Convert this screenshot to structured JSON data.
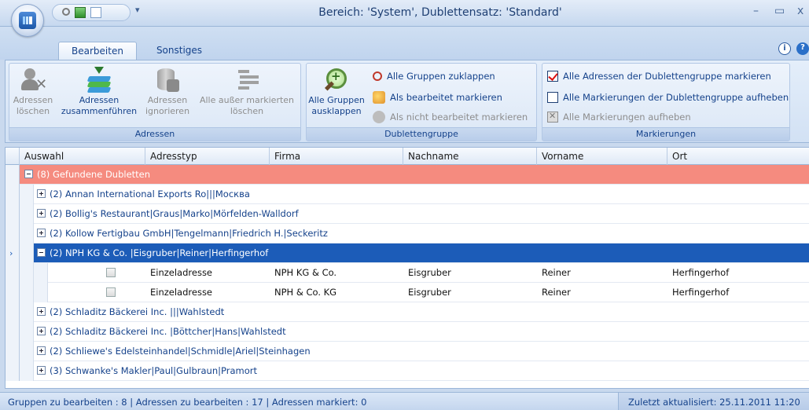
{
  "window": {
    "title": "Bereich: 'System', Dublettensatz: 'Standard'",
    "minimize": "–",
    "maximize": "▭",
    "close": "x",
    "qat_dropdown": "▾"
  },
  "tabs": [
    {
      "label": "Bearbeiten",
      "active": true
    },
    {
      "label": "Sonstiges",
      "active": false
    }
  ],
  "help": {
    "info": "i",
    "question": "?"
  },
  "ribbon": {
    "adressen": {
      "label": "Adressen",
      "delete": {
        "line1": "Adressen",
        "line2": "löschen"
      },
      "merge": {
        "line1": "Adressen",
        "line2": "zusammenführen"
      },
      "ignore": {
        "line1": "Adressen",
        "line2": "ignorieren"
      },
      "delete_except": {
        "line1": "Alle außer markierten",
        "line2": "löschen"
      }
    },
    "dublettengruppe": {
      "label": "Dublettengruppe",
      "expand_all": {
        "line1": "Alle Gruppen",
        "line2": "ausklappen"
      },
      "collapse_all": "Alle Gruppen zuklappen",
      "mark_processed": "Als bearbeitet markieren",
      "mark_unprocessed": "Als nicht bearbeitet markieren"
    },
    "markierungen": {
      "label": "Markierungen",
      "mark_all_in_group": "Alle Adressen der Dublettengruppe markieren",
      "unmark_all_in_group": "Alle Markierungen der Dublettengruppe aufheben",
      "unmark_all": "Alle Markierungen aufheben"
    }
  },
  "grid": {
    "columns": [
      "Auswahl",
      "Adresstyp",
      "Firma",
      "Nachname",
      "Vorname",
      "Ort"
    ],
    "root_group": "(8) Gefundene Dubletten",
    "groups": [
      "(2) Annan International Exports Ro|||Москва",
      "(2) Bollig's Restaurant|Graus|Marko|Mörfelden-Walldorf",
      "(2) Kollow Fertigbau GmbH|Tengelmann|Friedrich H.|Seckeritz",
      "(2) NPH KG & Co. |Eisgruber|Reiner|Herfingerhof",
      "(2) Schladitz Bäckerei Inc. |||Wahlstedt",
      "(2) Schladitz Bäckerei Inc. |Böttcher|Hans|Wahlstedt",
      "(2) Schliewe's Edelsteinhandel|Schmidle|Ariel|Steinhagen",
      "(3) Schwanke's Makler|Paul|Gulbraun|Pramort"
    ],
    "expanded_rows": [
      {
        "adresstyp": "Einzeladresse",
        "firma": "NPH KG & Co.",
        "nachname": "Eisgruber",
        "vorname": "Reiner",
        "ort": "Herfingerhof"
      },
      {
        "adresstyp": "Einzeladresse",
        "firma": "NPH & Co. KG",
        "nachname": "Eisgruber",
        "vorname": "Reiner",
        "ort": "Herfingerhof"
      }
    ],
    "current_row_marker": "›"
  },
  "status": {
    "left": "Gruppen zu bearbeiten : 8 | Adressen zu bearbeiten : 17 | Adressen markiert: 0",
    "right": "Zuletzt aktualisiert: 25.11.2011 11:20"
  },
  "colors": {
    "accent": "#15428b",
    "selected": "#1c5cb8",
    "root_group": "#f58b7f"
  }
}
